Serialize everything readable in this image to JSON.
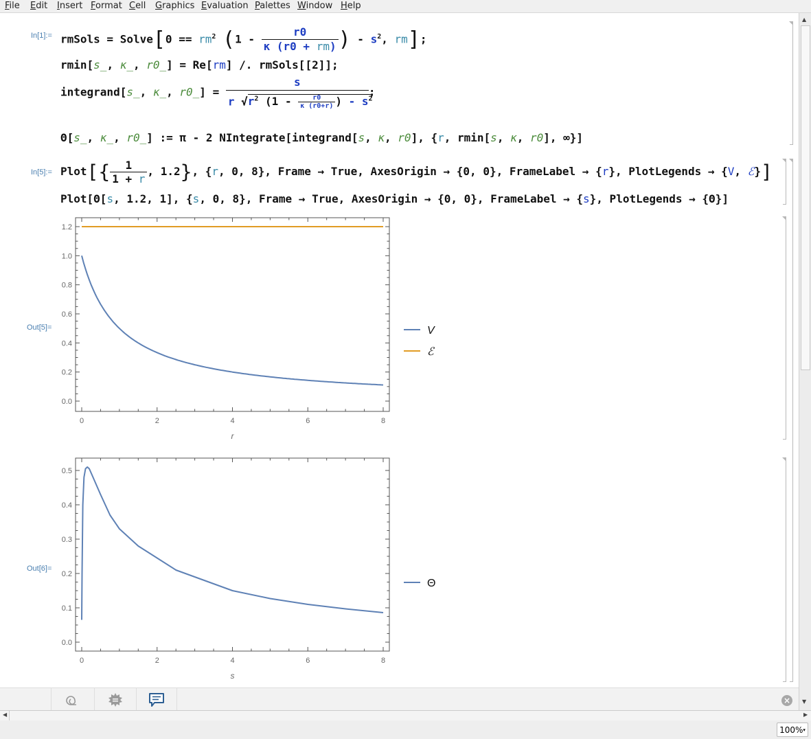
{
  "menu": [
    "File",
    "Edit",
    "Insert",
    "Format",
    "Cell",
    "Graphics",
    "Evaluation",
    "Palettes",
    "Window",
    "Help"
  ],
  "cells": {
    "in1_label": "In[1]:=",
    "in5_label": "In[5]:=",
    "out5_label": "Out[5]=",
    "out6_label": "Out[6]=",
    "line1": {
      "a": "rmSols = Solve",
      "b": "0 == ",
      "rm": "rm",
      "sup2": "2",
      "one": "1 - ",
      "num": "r0",
      "den_k": "κ",
      "den_rest": " (r0 + ",
      "den_rm": "rm",
      "den_close": ")",
      "tail1": " - ",
      "s": "s",
      "tail2": ", ",
      "rm2": "rm",
      "end": ";"
    },
    "line2": {
      "a": "rmin[",
      "s": "s_",
      "c1": ", ",
      "k": "κ_",
      "c2": ", ",
      "r0": "r0_",
      "b": "] = Re[",
      "rm": "rm",
      "c": "] /. rmSols[[2]];"
    },
    "line3": {
      "a": "integrand[",
      "s": "s_",
      "c1": ", ",
      "k": "κ_",
      "c2": ", ",
      "r0": "r0_",
      "b": "] = ",
      "num": "s",
      "den_r": "r",
      "sq_r": "r",
      "sq_sup": "2",
      "sq_one": "1 - ",
      "sq_num": "r0",
      "sq_den": "κ (r0+r)",
      "sq_tail": " - s",
      "sq_tail_sup": "2",
      "end": ";"
    },
    "line4": {
      "a": "Θ[",
      "s": "s_",
      "c1": ", ",
      "k": "κ_",
      "c2": ", ",
      "r0": "r0_",
      "b": "] := π - 2 NIntegrate[integrand[",
      "s2": "s",
      "c3": ", ",
      "k2": "κ",
      "c4": ", ",
      "r02": "r0",
      "c": "], {",
      "r": "r",
      "d": ", rmin[",
      "s3": "s",
      "c5": ", ",
      "k3": "κ",
      "c6": ", ",
      "r03": "r0",
      "e": "], ∞}]"
    },
    "line5": {
      "a": "Plot",
      "num": "1",
      "den": "1 + ",
      "den_r": "r",
      "b": ", 1.2",
      "c": ", {",
      "r": "r",
      "d": ", 0, 8}, Frame → True, AxesOrigin → {0, 0}, FrameLabel → {",
      "r2": "r",
      "e": "}, PlotLegends → {",
      "V": "V",
      "f": ", ",
      "E": "ℰ",
      "g": "}"
    },
    "line6": {
      "a": "Plot[Θ[",
      "s": "s",
      "b": ", 1.2, 1], {",
      "s2": "s",
      "c": ", 0, 8}, Frame → True, AxesOrigin → {0, 0}, FrameLabel → {",
      "s3": "s",
      "d": "}, PlotLegends → {Θ}]"
    }
  },
  "chart_data": [
    {
      "type": "line",
      "title": "",
      "xlabel": "r",
      "ylabel": "",
      "xlim": [
        0,
        8
      ],
      "ylim": [
        -0.05,
        1.22
      ],
      "xticks": [
        "0",
        "2",
        "4",
        "6",
        "8"
      ],
      "yticks": [
        "0.0",
        "0.2",
        "0.4",
        "0.6",
        "0.8",
        "1.0",
        "1.2"
      ],
      "legend_position": "right",
      "series": [
        {
          "name": "V",
          "color": "#5e81b5",
          "x": [
            0,
            0.25,
            0.5,
            0.75,
            1,
            1.5,
            2,
            2.5,
            3,
            3.5,
            4,
            5,
            6,
            7,
            8
          ],
          "y": [
            1.0,
            0.8,
            0.667,
            0.571,
            0.5,
            0.4,
            0.333,
            0.286,
            0.25,
            0.222,
            0.2,
            0.167,
            0.143,
            0.125,
            0.111
          ]
        },
        {
          "name": "ℰ",
          "color": "#e19c24",
          "x": [
            0,
            8
          ],
          "y": [
            1.2,
            1.2
          ]
        }
      ]
    },
    {
      "type": "line",
      "title": "",
      "xlabel": "s",
      "ylabel": "",
      "xlim": [
        0,
        8
      ],
      "ylim": [
        -0.03,
        0.53
      ],
      "xticks": [
        "0",
        "2",
        "4",
        "6",
        "8"
      ],
      "yticks": [
        "0.0",
        "0.1",
        "0.2",
        "0.3",
        "0.4",
        "0.5"
      ],
      "legend_position": "right",
      "series": [
        {
          "name": "Θ",
          "color": "#5e81b5",
          "x": [
            0,
            0.01,
            0.03,
            0.06,
            0.1,
            0.15,
            0.2,
            0.3,
            0.5,
            0.75,
            1,
            1.5,
            2,
            2.5,
            3,
            4,
            5,
            6,
            7,
            8
          ],
          "y": [
            0.065,
            0.2,
            0.4,
            0.48,
            0.505,
            0.51,
            0.505,
            0.48,
            0.43,
            0.37,
            0.33,
            0.28,
            0.245,
            0.21,
            0.19,
            0.15,
            0.127,
            0.11,
            0.097,
            0.086
          ]
        }
      ]
    }
  ],
  "toolbar": {
    "zoom_level": "100%"
  }
}
